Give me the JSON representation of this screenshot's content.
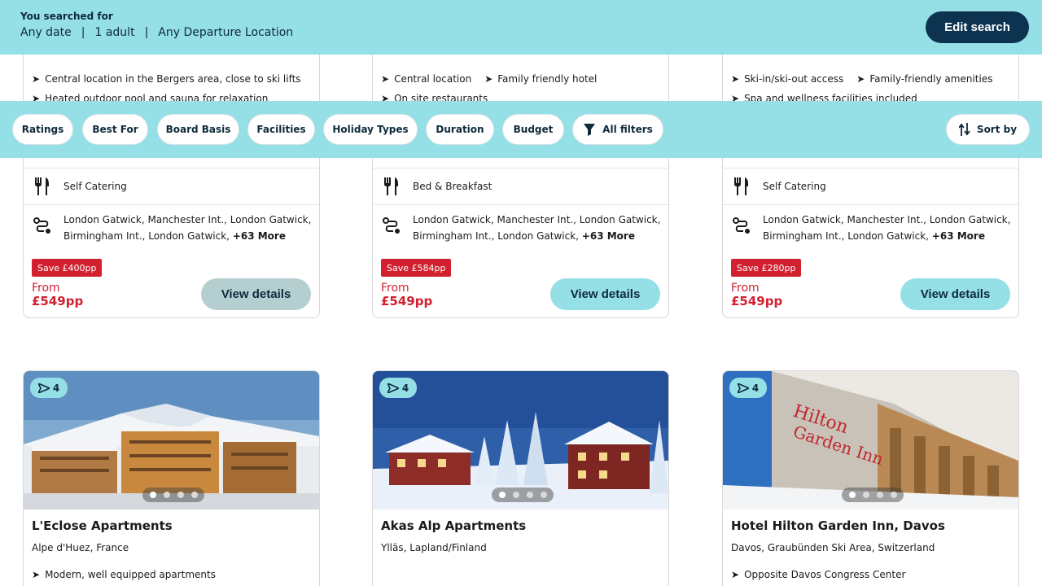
{
  "search": {
    "label": "You searched for",
    "date": "Any date",
    "travellers": "1 adult",
    "departure": "Any Departure Location",
    "separator": "|",
    "edit_label": "Edit search"
  },
  "filters": {
    "chips": [
      "Ratings",
      "Best For",
      "Board Basis",
      "Facilities",
      "Holiday Types",
      "Duration",
      "Budget"
    ],
    "all_filters": "All filters",
    "sort_by": "Sort by"
  },
  "top_cards": [
    {
      "bullets": [
        "Central location in the Bergers area, close to ski lifts",
        "Heated outdoor pool and sauna for relaxation"
      ],
      "board": "Self Catering",
      "airports_line1": "London Gatwick, Manchester Int., London Gatwick,",
      "airports_line2": "Birmingham Int., London Gatwick,",
      "more": "+63 More",
      "save": "Save £400pp",
      "from": "From",
      "price": "£549pp",
      "view": "View details"
    },
    {
      "bullets": [
        "Central location",
        "Family friendly hotel",
        "On site restaurants"
      ],
      "board": "Bed & Breakfast",
      "airports_line1": "London Gatwick, Manchester Int., London Gatwick,",
      "airports_line2": "Birmingham Int., London Gatwick,",
      "more": "+63 More",
      "save": "Save £584pp",
      "from": "From",
      "price": "£549pp",
      "view": "View details"
    },
    {
      "bullets": [
        "Ski-in/ski-out access",
        "Family-friendly amenities",
        "Spa and wellness facilities included"
      ],
      "board": "Self Catering",
      "airports_line1": "London Gatwick, Manchester Int., London Gatwick,",
      "airports_line2": "Birmingham Int., London Gatwick,",
      "more": "+63 More",
      "save": "Save £280pp",
      "from": "From",
      "price": "£549pp",
      "view": "View details"
    }
  ],
  "bottom_cards": [
    {
      "rating": "4",
      "name": "L'Eclose Apartments",
      "location": "Alpe d'Huez, France",
      "bullet": "Modern, well equipped apartments",
      "active_dot": 0
    },
    {
      "rating": "4",
      "name": "Akas Alp Apartments",
      "location": "Ylläs, Lapland/Finland",
      "bullet": "",
      "active_dot": 0
    },
    {
      "rating": "4",
      "name": "Hotel Hilton Garden Inn, Davos",
      "location": "Davos, Graubünden Ski Area, Switzerland",
      "bullet": "Opposite Davos Congress Center",
      "active_dot": 0
    }
  ],
  "icons": {
    "bullet": "arrow-bullet-icon",
    "board": "fork-knife-icon",
    "airports": "route-icon",
    "rating": "paper-plane-icon",
    "filter": "funnel-icon",
    "sort": "sort-arrows-icon"
  },
  "colors": {
    "header_bg": "#95dfe6",
    "edit_btn": "#0d3350",
    "save_badge": "#d2202f",
    "price": "#d2202f"
  }
}
